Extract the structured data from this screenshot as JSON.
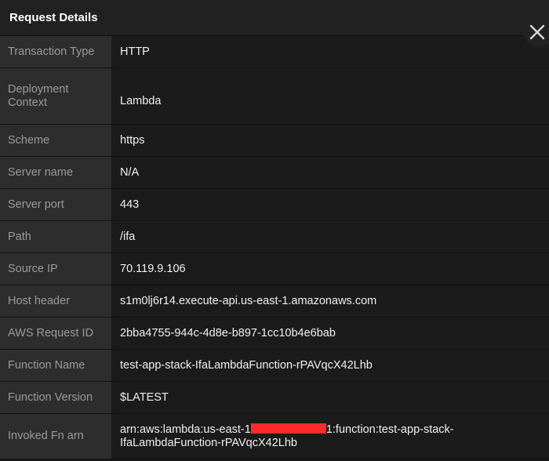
{
  "dialog": {
    "title": "Request Details"
  },
  "colors": {
    "redaction": "#ff2a2a",
    "label_bg": "#2d2d2d",
    "value_bg": "#1b1b1b"
  },
  "rows": [
    {
      "label": "Transaction Type",
      "value": "HTTP"
    },
    {
      "label": "Deployment Context",
      "value": "Lambda"
    },
    {
      "label": "Scheme",
      "value": "https"
    },
    {
      "label": "Server name",
      "value": "N/A"
    },
    {
      "label": "Server port",
      "value": "443"
    },
    {
      "label": "Path",
      "value": "/ifa"
    },
    {
      "label": "Source IP",
      "value": "70.119.9.106"
    },
    {
      "label": "Host header",
      "value": "s1m0lj6r14.execute-api.us-east-1.amazonaws.com"
    },
    {
      "label": "AWS Request ID",
      "value": "2bba4755-944c-4d8e-b897-1cc10b4e6bab"
    },
    {
      "label": "Function Name",
      "value": "test-app-stack-IfaLambdaFunction-rPAVqcX42Lhb"
    },
    {
      "label": "Function Version",
      "value": "$LATEST"
    },
    {
      "label": "Invoked Fn arn",
      "value_prefix": "arn:aws:lambda:us-east-1",
      "value_suffix": "1:function:test-app-stack-IfaLambdaFunction-rPAVqcX42Lhb"
    }
  ]
}
